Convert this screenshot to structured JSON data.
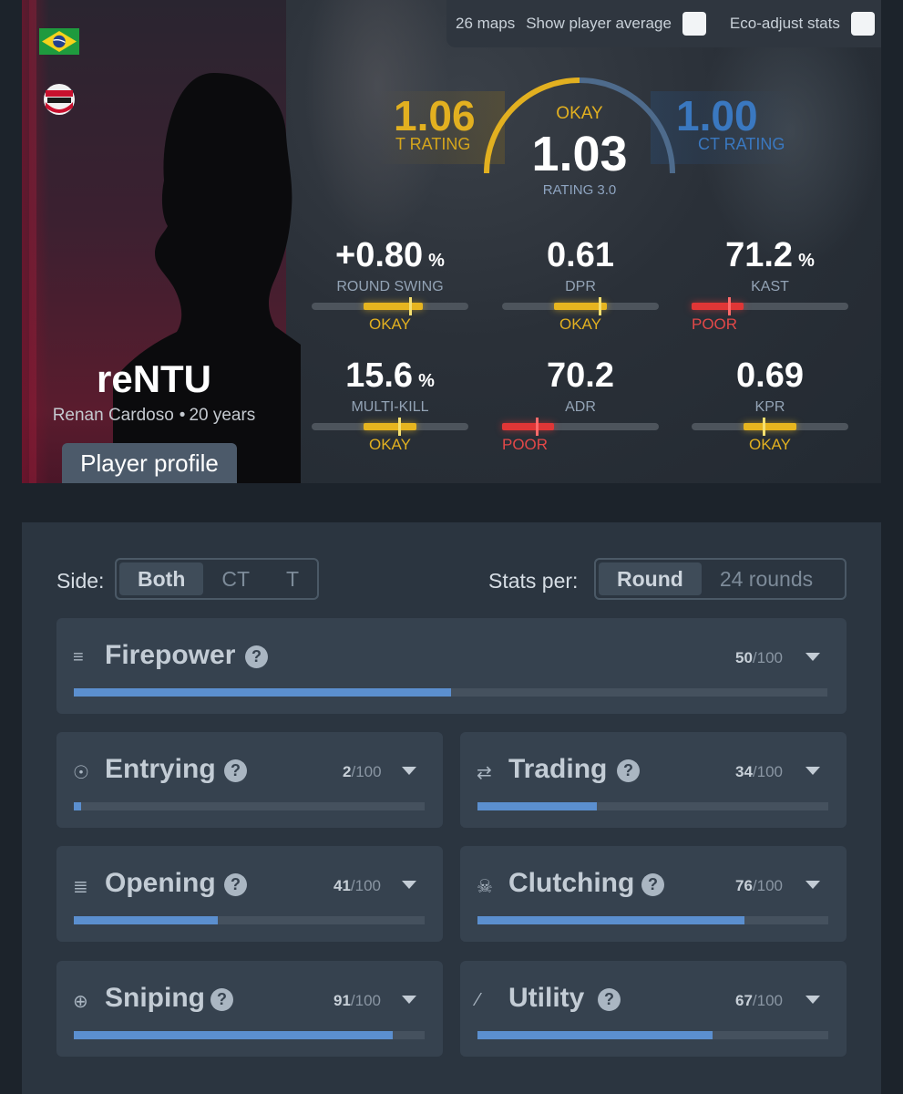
{
  "header": {
    "maps_count": "26 maps",
    "show_avg_label": "Show player average",
    "eco_adjust_label": "Eco-adjust stats"
  },
  "player": {
    "nickname": "reNTU",
    "real_name": "Renan Cardoso",
    "age": "20 years",
    "profile_button": "Player profile",
    "country_flag": "brazil-flag-icon",
    "team_logo": "red-canids-logo"
  },
  "rating": {
    "t_value": "1.06",
    "t_label": "T RATING",
    "ct_value": "1.00",
    "ct_label": "CT RATING",
    "verdict": "OKAY",
    "value": "1.03",
    "label": "RATING 3.0"
  },
  "stats": [
    {
      "value": "+0.80",
      "unit": "%",
      "label": "ROUND SWING",
      "verdict": "OKAY",
      "level": "okay",
      "fill_start": 0.33,
      "fill_end": 0.71,
      "marker": 0.63
    },
    {
      "value": "0.61",
      "unit": "",
      "label": "DPR",
      "verdict": "OKAY",
      "level": "okay",
      "fill_start": 0.33,
      "fill_end": 0.67,
      "marker": 0.62
    },
    {
      "value": "71.2",
      "unit": "%",
      "label": "KAST",
      "verdict": "POOR",
      "level": "poor",
      "fill_start": 0.0,
      "fill_end": 0.33,
      "marker": 0.24
    },
    {
      "value": "15.6",
      "unit": "%",
      "label": "MULTI-KILL",
      "verdict": "OKAY",
      "level": "okay",
      "fill_start": 0.33,
      "fill_end": 0.67,
      "marker": 0.56
    },
    {
      "value": "70.2",
      "unit": "",
      "label": "ADR",
      "verdict": "POOR",
      "level": "poor",
      "fill_start": 0.0,
      "fill_end": 0.33,
      "marker": 0.22
    },
    {
      "value": "0.69",
      "unit": "",
      "label": "KPR",
      "verdict": "OKAY",
      "level": "okay",
      "fill_start": 0.33,
      "fill_end": 0.67,
      "marker": 0.46
    }
  ],
  "filters": {
    "side_label": "Side:",
    "side_options": [
      "Both",
      "CT",
      "T"
    ],
    "side_selected": "Both",
    "per_label": "Stats per:",
    "per_options": [
      "Round",
      "24 rounds"
    ],
    "per_selected": "Round"
  },
  "categories": [
    {
      "name": "Firepower",
      "icon": "firepower-icon",
      "score": "50",
      "max": "/100"
    },
    {
      "name": "Entrying",
      "icon": "entrying-icon",
      "score": "2",
      "max": "/100"
    },
    {
      "name": "Trading",
      "icon": "trading-icon",
      "score": "34",
      "max": "/100"
    },
    {
      "name": "Opening",
      "icon": "opening-icon",
      "score": "41",
      "max": "/100"
    },
    {
      "name": "Clutching",
      "icon": "clutching-icon",
      "score": "76",
      "max": "/100"
    },
    {
      "name": "Sniping",
      "icon": "sniping-icon",
      "score": "91",
      "max": "/100"
    },
    {
      "name": "Utility",
      "icon": "utility-icon",
      "score": "67",
      "max": "/100"
    }
  ],
  "colors": {
    "t_side": "#e2b020",
    "ct_side": "#3a78c0",
    "okay": "#e7b51f",
    "poor": "#e03636",
    "category_fill": "#5b8fcf"
  }
}
